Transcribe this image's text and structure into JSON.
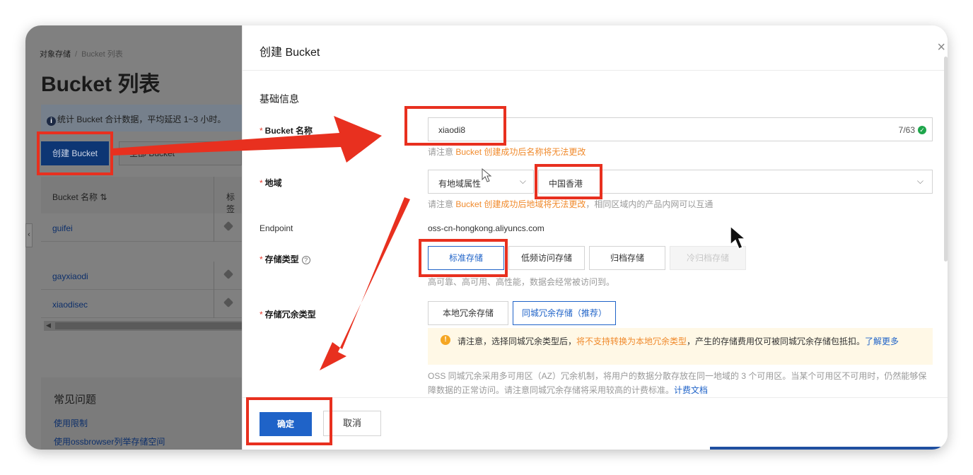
{
  "left_page": {
    "breadcrumb": [
      "对象存储",
      "Bucket 列表"
    ],
    "breadcrumb_sep": "/",
    "title": "Bucket 列表",
    "notice": "统计 Bucket 合计数据，平均延迟 1~3 小时。",
    "create_button": "创建 Bucket",
    "all_filter": "全部 Bucket",
    "table_headers": [
      "Bucket 名称",
      "标签"
    ],
    "rows": [
      "guifei",
      "gayxiaodi",
      "xiaodisec"
    ],
    "faq_title": "常见问题",
    "faq_links": [
      "使用限制",
      "使用ossbrowser列举存储空间"
    ]
  },
  "drawer": {
    "title": "创建 Bucket",
    "close": "×",
    "section": "基础信息",
    "name_label": "Bucket 名称",
    "name_value": "xiaodi8",
    "name_count": "7/63",
    "name_hint_prefix": "请注意 ",
    "name_hint_orange": "Bucket 创建成功后名称将无法更改",
    "region_label": "地域",
    "region_type": "有地域属性",
    "region_value": "中国香港",
    "region_hint_prefix": "请注意 ",
    "region_hint_orange": "Bucket 创建成功后地域将无法更改",
    "region_hint_suffix": "，相同区域内的产品内网可以互通",
    "endpoint_label": "Endpoint",
    "endpoint_value": "oss-cn-hongkong.aliyuncs.com",
    "storage_label": "存储类型",
    "storage_options": [
      "标准存储",
      "低频访问存储",
      "归档存储",
      "冷归档存储"
    ],
    "storage_hint": "高可靠、高可用、高性能，数据会经常被访问到。",
    "redundancy_label": "存储冗余类型",
    "redundancy_options": [
      "本地冗余存储",
      "同城冗余存储（推荐）"
    ],
    "warn_prefix": "请注意，选择同城冗余类型后，",
    "warn_orange": "将不支持转换为本地冗余类型",
    "warn_suffix": "，产生的存储费用仅可被同城冗余存储包抵扣。",
    "warn_link": "了解更多",
    "desc_text": "OSS 同城冗余采用多可用区（AZ）冗余机制，将用户的数据分散存放在同一地域的 3 个可用区。当某个可用区不可用时，仍然能够保障数据的正常访问。请注意同城冗余存储将采用较高的计费标准。",
    "desc_link": "计费文档",
    "ok_button": "确定",
    "cancel_button": "取消"
  },
  "colors": {
    "primary": "#1f63c8",
    "warning_text": "#f08a2c",
    "annotation_red": "#e8301f",
    "success": "#1ea64b"
  }
}
